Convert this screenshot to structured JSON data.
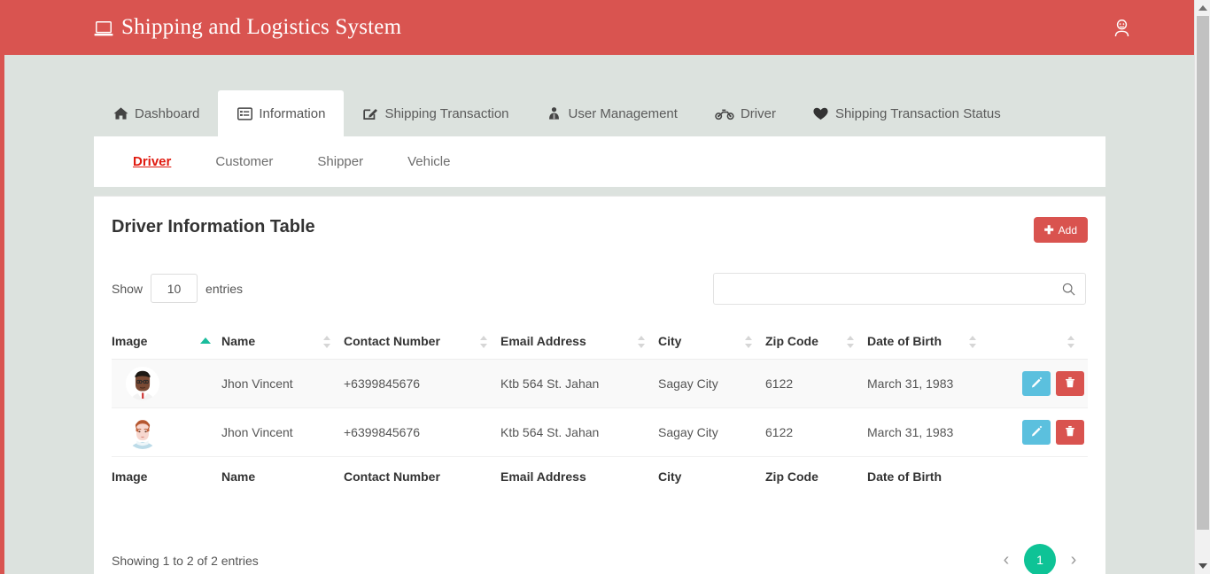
{
  "colors": {
    "brand_red": "#d95450",
    "page_bg": "#dce2de",
    "accent_green": "#0ec396",
    "edit_blue": "#5bc0de",
    "delete_red": "#d9534f",
    "active_link_red": "#e01a0f"
  },
  "header": {
    "title": "Shipping and Logistics System",
    "brand_icon": "laptop-icon",
    "user_icon": "user-circle-icon"
  },
  "tabs": [
    {
      "label": "Dashboard",
      "icon": "home-icon",
      "active": false
    },
    {
      "label": "Information",
      "icon": "list-alt-icon",
      "active": true
    },
    {
      "label": "Shipping Transaction",
      "icon": "pencil-square-icon",
      "active": false
    },
    {
      "label": "User Management",
      "icon": "users-icon",
      "active": false
    },
    {
      "label": "Driver",
      "icon": "motorcycle-icon",
      "active": false
    },
    {
      "label": "Shipping Transaction Status",
      "icon": "heart-icon",
      "active": false
    }
  ],
  "subnav": [
    {
      "label": "Driver",
      "active": true
    },
    {
      "label": "Customer",
      "active": false
    },
    {
      "label": "Shipper",
      "active": false
    },
    {
      "label": "Vehicle",
      "active": false
    }
  ],
  "card": {
    "title": "Driver Information Table",
    "add_label": "Add",
    "add_icon": "plus-icon"
  },
  "controls": {
    "show_label": "Show",
    "entries_label": "entries",
    "page_length": "10",
    "search_value": "",
    "search_placeholder": "",
    "search_icon": "search-icon"
  },
  "table": {
    "columns": [
      {
        "label": "Image",
        "sort": "asc"
      },
      {
        "label": "Name",
        "sort": "none"
      },
      {
        "label": "Contact Number",
        "sort": "none"
      },
      {
        "label": "Email Address",
        "sort": "none"
      },
      {
        "label": "City",
        "sort": "none"
      },
      {
        "label": "Zip Code",
        "sort": "none"
      },
      {
        "label": "Date of Birth",
        "sort": "none"
      },
      {
        "label": "",
        "sort": "none"
      }
    ],
    "rows": [
      {
        "image": "avatar-man-glasses",
        "name": "Jhon Vincent",
        "contact": "+6399845676",
        "email": "Ktb 564 St. Jahan",
        "city": "Sagay City",
        "zip": "6122",
        "dob": "March 31, 1983",
        "edit_icon": "pencil-icon",
        "delete_icon": "trash-icon"
      },
      {
        "image": "avatar-person-auburn",
        "name": "Jhon Vincent",
        "contact": "+6399845676",
        "email": "Ktb 564 St. Jahan",
        "city": "Sagay City",
        "zip": "6122",
        "dob": "March 31, 1983",
        "edit_icon": "pencil-icon",
        "delete_icon": "trash-icon"
      }
    ],
    "footer_columns": [
      "Image",
      "Name",
      "Contact Number",
      "Email Address",
      "City",
      "Zip Code",
      "Date of Birth",
      ""
    ]
  },
  "pagination": {
    "info": "Showing 1 to 2 of 2 entries",
    "previous_icon": "chevron-left-icon",
    "next_icon": "chevron-right-icon",
    "pages": [
      "1"
    ],
    "current_page": "1"
  }
}
